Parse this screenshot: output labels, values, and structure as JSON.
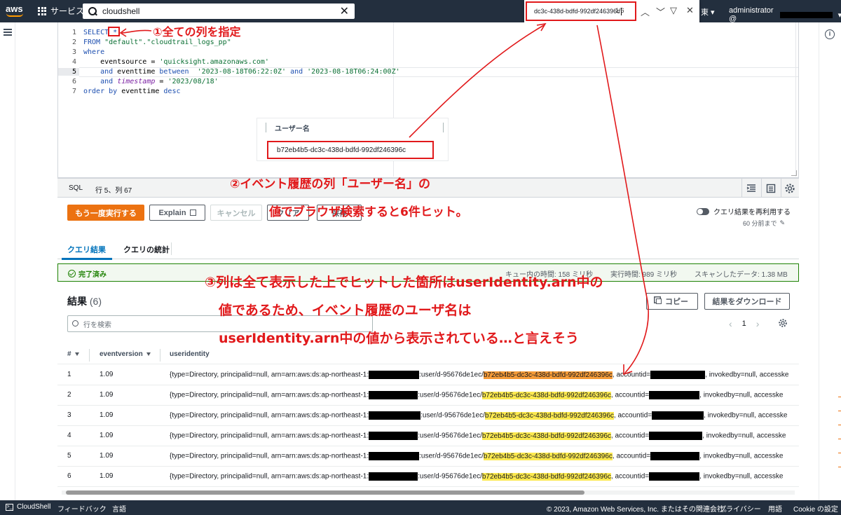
{
  "nav": {
    "logo": "aws",
    "services_label": "サービス",
    "search_value": "cloudshell",
    "find_query": "dc3c-438d-bdfd-992df246396c",
    "find_count": "1/6",
    "region_frag": "東",
    "account_label": "administrator @"
  },
  "editor": {
    "line_numbers": [
      "1",
      "2",
      "3",
      "4",
      "5",
      "6",
      "7"
    ],
    "lines": [
      "SELECT *",
      "FROM \"default\".\"cloudtrail_logs_pp\"",
      "where",
      "    eventsource = 'quicksight.amazonaws.com'",
      "    and eventtime between  '2023-08-18T06:22:0Z' and '2023-08-18T06:24:00Z'",
      "    and timestamp = '2023/08/18'",
      "order by eventtime desc"
    ],
    "lang": "SQL",
    "cursor_pos": "行 5、列 67"
  },
  "user_popup": {
    "header": "ユーザー名",
    "value": "b72eb4b5-dc3c-438d-bdfd-992df246396c"
  },
  "buttons": {
    "rerun": "もう一度実行する",
    "explain": "Explain",
    "cancel": "キャンセル",
    "clear": "クリア",
    "save": "保存"
  },
  "reuse": {
    "label": "クエリ結果を再利用する",
    "sub": "60 分前まで"
  },
  "tabs": [
    "クエリ結果",
    "クエリの統計"
  ],
  "status": {
    "done": "完了済み",
    "queue": "キュー内の時間: 158 ミリ秒",
    "exec": "実行時間: 989 ミリ秒",
    "scan": "スキャンしたデータ: 1.38 MB"
  },
  "results": {
    "title": "結果",
    "count": "(6)",
    "copy": "コピー",
    "download": "結果をダウンロード",
    "search_placeholder": "行を検索",
    "page": "1",
    "columns": [
      "#",
      "eventversion",
      "useridentity"
    ],
    "rows": [
      {
        "n": "1",
        "ver": "1.09",
        "pre": "{type=Directory, principalid=null, arn=arn:aws:ds:ap-northeast-1:",
        "mid": ":user/d-95676de1ec/",
        "match": "b72eb4b5-dc3c-438d-bdfd-992df246396c",
        "post": ", accountid=",
        "tail": ", invokedby=null, accesske"
      },
      {
        "n": "2",
        "ver": "1.09",
        "pre": "{type=Directory, principalid=null, arn=arn:aws:ds:ap-northeast-1:",
        "mid": ":user/d-95676de1ec/",
        "match": "b72eb4b5-dc3c-438d-bdfd-992df246396c",
        "post": ", accountid=",
        "tail": ", invokedby=null, accesske"
      },
      {
        "n": "3",
        "ver": "1.09",
        "pre": "{type=Directory, principalid=null, arn=arn:aws:ds:ap-northeast-1:",
        "mid": ":user/d-95676de1ec/",
        "match": "b72eb4b5-dc3c-438d-bdfd-992df246396c",
        "post": ", accountid=",
        "tail": ", invokedby=null, accesske"
      },
      {
        "n": "4",
        "ver": "1.09",
        "pre": "{type=Directory, principalid=null, arn=arn:aws:ds:ap-northeast-1:",
        "mid": ":user/d-95676de1ec/",
        "match": "b72eb4b5-dc3c-438d-bdfd-992df246396c",
        "post": ", accountid=",
        "tail": ", invokedby=null, accesske"
      },
      {
        "n": "5",
        "ver": "1.09",
        "pre": "{type=Directory, principalid=null, arn=arn:aws:ds:ap-northeast-1:",
        "mid": ":user/d-95676de1ec/",
        "match": "b72eb4b5-dc3c-438d-bdfd-992df246396c",
        "post": ", accountid=",
        "tail": ", invokedby=null, accesske"
      },
      {
        "n": "6",
        "ver": "1.09",
        "pre": "{type=Directory, principalid=null, arn=arn:aws:ds:ap-northeast-1:",
        "mid": ":user/d-95676de1ec/",
        "match": "b72eb4b5-dc3c-438d-bdfd-992df246396c",
        "post": ", accountid=",
        "tail": ", invokedby=null, accesske"
      }
    ]
  },
  "footer": {
    "cloudshell": "CloudShell",
    "feedback": "フィードバック",
    "language": "言語",
    "copyright": "© 2023, Amazon Web Services, Inc. またはその関連会社。",
    "privacy": "プライバシー",
    "terms": "用語",
    "cookie": "Cookie の設定"
  },
  "annotations": {
    "a1": "①全ての列を指定",
    "a2_line1": "②イベント履歴の列「ユーザー名」の",
    "a2_line2": "値でブラウザ検索すると6件ヒット。",
    "a3_line1": "③列は全て表示した上でヒットした箇所はuserIdentity.arn中の",
    "a3_line2": "値であるため、イベント履歴のユーザ名は",
    "a3_line3": "userIdentity.arn中の値から表示されている…と言えそう"
  },
  "colors": {
    "nav_bg": "#232f3e",
    "primary": "#ec7211",
    "annotation_red": "#e1191b",
    "highlight": "#fce94f",
    "highlight_current": "#f59b38",
    "success": "#1d8102"
  }
}
